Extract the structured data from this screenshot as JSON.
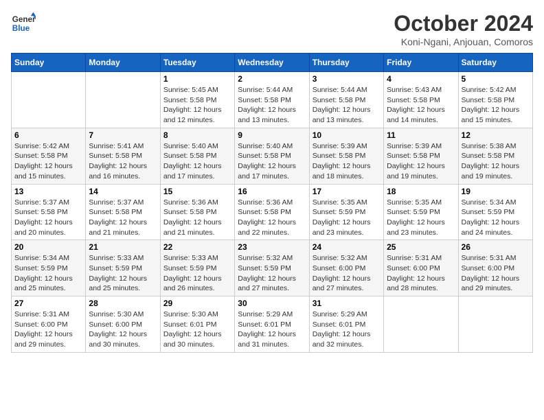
{
  "logo": {
    "line1": "General",
    "line2": "Blue"
  },
  "title": "October 2024",
  "location": "Koni-Ngani, Anjouan, Comoros",
  "days_header": [
    "Sunday",
    "Monday",
    "Tuesday",
    "Wednesday",
    "Thursday",
    "Friday",
    "Saturday"
  ],
  "weeks": [
    [
      {
        "day": "",
        "info": ""
      },
      {
        "day": "",
        "info": ""
      },
      {
        "day": "1",
        "info": "Sunrise: 5:45 AM\nSunset: 5:58 PM\nDaylight: 12 hours and 12 minutes."
      },
      {
        "day": "2",
        "info": "Sunrise: 5:44 AM\nSunset: 5:58 PM\nDaylight: 12 hours and 13 minutes."
      },
      {
        "day": "3",
        "info": "Sunrise: 5:44 AM\nSunset: 5:58 PM\nDaylight: 12 hours and 13 minutes."
      },
      {
        "day": "4",
        "info": "Sunrise: 5:43 AM\nSunset: 5:58 PM\nDaylight: 12 hours and 14 minutes."
      },
      {
        "day": "5",
        "info": "Sunrise: 5:42 AM\nSunset: 5:58 PM\nDaylight: 12 hours and 15 minutes."
      }
    ],
    [
      {
        "day": "6",
        "info": "Sunrise: 5:42 AM\nSunset: 5:58 PM\nDaylight: 12 hours and 15 minutes."
      },
      {
        "day": "7",
        "info": "Sunrise: 5:41 AM\nSunset: 5:58 PM\nDaylight: 12 hours and 16 minutes."
      },
      {
        "day": "8",
        "info": "Sunrise: 5:40 AM\nSunset: 5:58 PM\nDaylight: 12 hours and 17 minutes."
      },
      {
        "day": "9",
        "info": "Sunrise: 5:40 AM\nSunset: 5:58 PM\nDaylight: 12 hours and 17 minutes."
      },
      {
        "day": "10",
        "info": "Sunrise: 5:39 AM\nSunset: 5:58 PM\nDaylight: 12 hours and 18 minutes."
      },
      {
        "day": "11",
        "info": "Sunrise: 5:39 AM\nSunset: 5:58 PM\nDaylight: 12 hours and 19 minutes."
      },
      {
        "day": "12",
        "info": "Sunrise: 5:38 AM\nSunset: 5:58 PM\nDaylight: 12 hours and 19 minutes."
      }
    ],
    [
      {
        "day": "13",
        "info": "Sunrise: 5:37 AM\nSunset: 5:58 PM\nDaylight: 12 hours and 20 minutes."
      },
      {
        "day": "14",
        "info": "Sunrise: 5:37 AM\nSunset: 5:58 PM\nDaylight: 12 hours and 21 minutes."
      },
      {
        "day": "15",
        "info": "Sunrise: 5:36 AM\nSunset: 5:58 PM\nDaylight: 12 hours and 21 minutes."
      },
      {
        "day": "16",
        "info": "Sunrise: 5:36 AM\nSunset: 5:58 PM\nDaylight: 12 hours and 22 minutes."
      },
      {
        "day": "17",
        "info": "Sunrise: 5:35 AM\nSunset: 5:59 PM\nDaylight: 12 hours and 23 minutes."
      },
      {
        "day": "18",
        "info": "Sunrise: 5:35 AM\nSunset: 5:59 PM\nDaylight: 12 hours and 23 minutes."
      },
      {
        "day": "19",
        "info": "Sunrise: 5:34 AM\nSunset: 5:59 PM\nDaylight: 12 hours and 24 minutes."
      }
    ],
    [
      {
        "day": "20",
        "info": "Sunrise: 5:34 AM\nSunset: 5:59 PM\nDaylight: 12 hours and 25 minutes."
      },
      {
        "day": "21",
        "info": "Sunrise: 5:33 AM\nSunset: 5:59 PM\nDaylight: 12 hours and 25 minutes."
      },
      {
        "day": "22",
        "info": "Sunrise: 5:33 AM\nSunset: 5:59 PM\nDaylight: 12 hours and 26 minutes."
      },
      {
        "day": "23",
        "info": "Sunrise: 5:32 AM\nSunset: 5:59 PM\nDaylight: 12 hours and 27 minutes."
      },
      {
        "day": "24",
        "info": "Sunrise: 5:32 AM\nSunset: 6:00 PM\nDaylight: 12 hours and 27 minutes."
      },
      {
        "day": "25",
        "info": "Sunrise: 5:31 AM\nSunset: 6:00 PM\nDaylight: 12 hours and 28 minutes."
      },
      {
        "day": "26",
        "info": "Sunrise: 5:31 AM\nSunset: 6:00 PM\nDaylight: 12 hours and 29 minutes."
      }
    ],
    [
      {
        "day": "27",
        "info": "Sunrise: 5:31 AM\nSunset: 6:00 PM\nDaylight: 12 hours and 29 minutes."
      },
      {
        "day": "28",
        "info": "Sunrise: 5:30 AM\nSunset: 6:00 PM\nDaylight: 12 hours and 30 minutes."
      },
      {
        "day": "29",
        "info": "Sunrise: 5:30 AM\nSunset: 6:01 PM\nDaylight: 12 hours and 30 minutes."
      },
      {
        "day": "30",
        "info": "Sunrise: 5:29 AM\nSunset: 6:01 PM\nDaylight: 12 hours and 31 minutes."
      },
      {
        "day": "31",
        "info": "Sunrise: 5:29 AM\nSunset: 6:01 PM\nDaylight: 12 hours and 32 minutes."
      },
      {
        "day": "",
        "info": ""
      },
      {
        "day": "",
        "info": ""
      }
    ]
  ]
}
